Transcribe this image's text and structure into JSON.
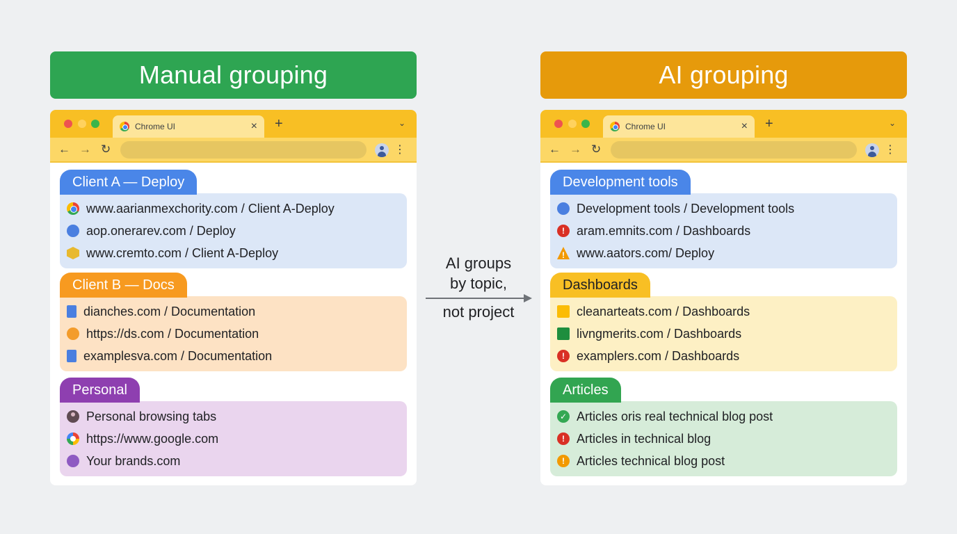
{
  "left": {
    "title": "Manual grouping",
    "browser": {
      "tab_title": "Chrome UI",
      "tab_close": "×",
      "new_tab": "+",
      "tab_menu": "⌄",
      "back": "←",
      "forward": "→",
      "reload": "↻",
      "menu": "⋮"
    },
    "groups": [
      {
        "label": "Client A — Deploy",
        "color": "#4a86e8",
        "items": [
          {
            "icon": "chrome-icon",
            "text": "www.aarianmexchority.com / Client A-Deploy"
          },
          {
            "icon": "globe-icon",
            "text": "aop.onerarev.com / Deploy"
          },
          {
            "icon": "package-icon",
            "text": "www.cremto.com / Client A-Deploy"
          }
        ]
      },
      {
        "label": "Client B — Docs",
        "color": "#f79a20",
        "items": [
          {
            "icon": "document-icon",
            "text": "dianches.com / Documentation"
          },
          {
            "icon": "globe-icon",
            "text": "https://ds.com / Documentation"
          },
          {
            "icon": "document-icon",
            "text": "examplesva.com / Documentation"
          }
        ]
      },
      {
        "label": "Personal",
        "color": "#8e3fb0",
        "items": [
          {
            "icon": "person-icon",
            "text": "Personal browsing tabs"
          },
          {
            "icon": "google-icon",
            "text": "https://www.google.com"
          },
          {
            "icon": "globe-icon",
            "text": "Your brands.com"
          }
        ]
      }
    ]
  },
  "middle": {
    "line1": "AI groups",
    "line2": "by topic,",
    "line3": "not project"
  },
  "right": {
    "title": "AI grouping",
    "browser": {
      "tab_title": "Chrome UI",
      "tab_close": "×",
      "new_tab": "+",
      "tab_menu": "⌄",
      "back": "←",
      "forward": "→",
      "reload": "↻",
      "menu": "⋮"
    },
    "groups": [
      {
        "label": "Development tools",
        "color": "#4a86e8",
        "items": [
          {
            "icon": "devtools-icon",
            "text": "Development tools / Development tools"
          },
          {
            "icon": "error-icon",
            "text": "aram.emnits.com / Dashboards"
          },
          {
            "icon": "warning-icon",
            "text": "www.aators.com/ Deploy"
          }
        ]
      },
      {
        "label": "Dashboards",
        "color": "#f8bf24",
        "items": [
          {
            "icon": "chart-icon",
            "text": "cleanarteats.com / Dashboards"
          },
          {
            "icon": "bar-chart-icon",
            "text": "livngmerits.com / Dashboards"
          },
          {
            "icon": "error-icon",
            "text": "examplers.com / Dashboards"
          }
        ]
      },
      {
        "label": "Articles",
        "color": "#32a551",
        "items": [
          {
            "icon": "check-icon",
            "text": "Articles oris real technical blog post"
          },
          {
            "icon": "error-icon",
            "text": "Articles in technical blog"
          },
          {
            "icon": "alert-icon",
            "text": "Articles technical blog post"
          }
        ]
      }
    ]
  }
}
